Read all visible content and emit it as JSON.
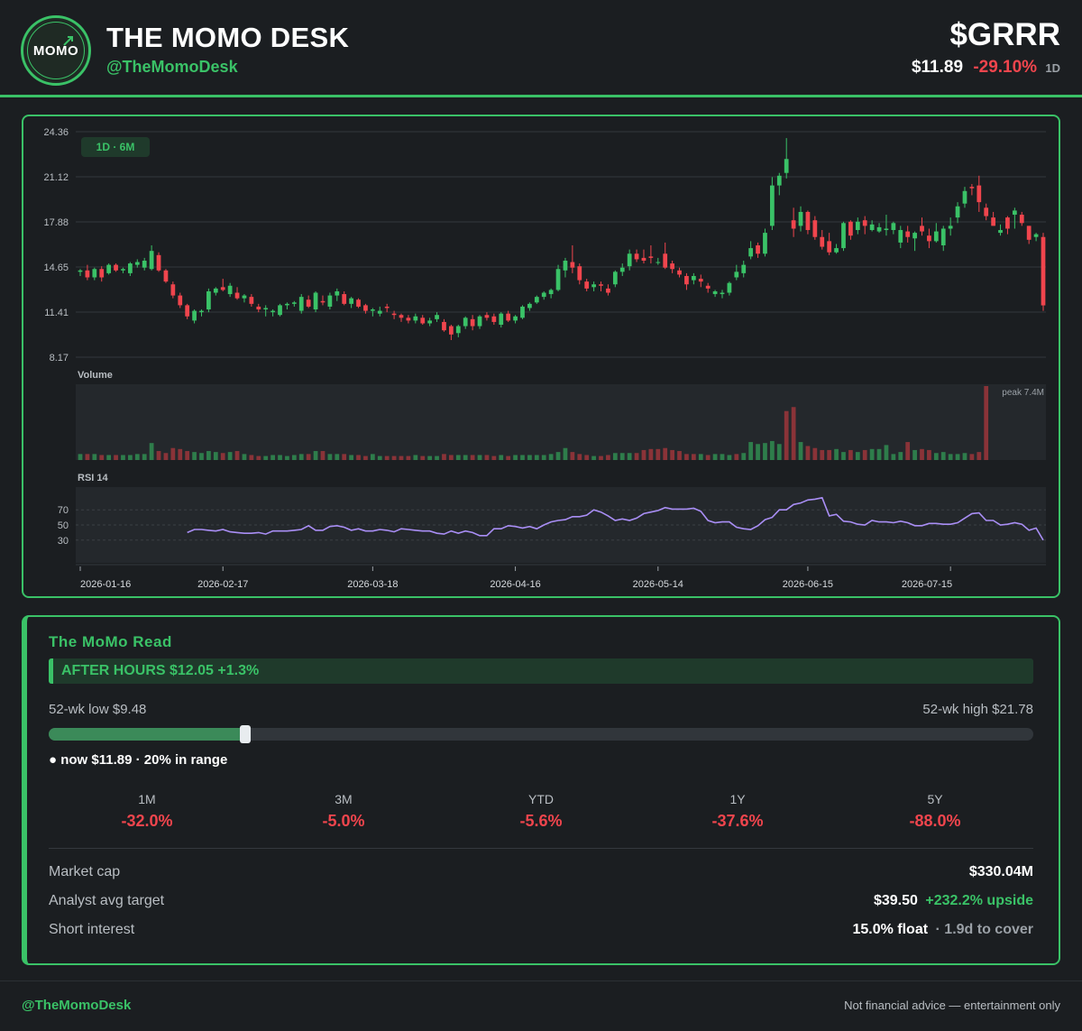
{
  "header": {
    "logo_text": "MOMO",
    "brand_name": "THE MOMO DESK",
    "handle": "@TheMomoDesk",
    "ticker": "$GRRR",
    "price": "$11.89",
    "change": "-29.10%",
    "period": "1D"
  },
  "colors": {
    "accent": "#3ac267",
    "up": "#3ac267",
    "down": "#f0454d",
    "rsi_line": "#a98ef5",
    "background": "#1b1e21"
  },
  "chart_data": {
    "type": "candlestick",
    "badge": "1D · 6M",
    "y_ticks": [
      24.36,
      21.12,
      17.88,
      14.65,
      11.41,
      8.17
    ],
    "ylim": [
      8.17,
      24.36
    ],
    "x_tick_labels": [
      "2026-01-16",
      "2026-02-17",
      "2026-03-18",
      "2026-04-16",
      "2026-05-14",
      "2026-06-15",
      "2026-07-15"
    ],
    "x_tick_index": [
      0,
      20,
      41,
      61,
      81,
      102,
      122
    ],
    "ohlc": [
      [
        14.3,
        14.5,
        14.0,
        14.4
      ],
      [
        14.4,
        14.8,
        13.7,
        13.9
      ],
      [
        13.9,
        14.6,
        13.7,
        14.5
      ],
      [
        14.5,
        14.7,
        13.6,
        13.9
      ],
      [
        14.2,
        14.9,
        14.1,
        14.8
      ],
      [
        14.8,
        14.9,
        14.3,
        14.4
      ],
      [
        14.4,
        14.6,
        14.2,
        14.5
      ],
      [
        14.2,
        15.0,
        14.0,
        14.9
      ],
      [
        14.8,
        15.2,
        14.6,
        15.0
      ],
      [
        14.6,
        15.3,
        14.4,
        15.1
      ],
      [
        14.5,
        16.2,
        14.4,
        15.8
      ],
      [
        15.5,
        15.7,
        14.3,
        14.4
      ],
      [
        14.4,
        14.5,
        13.5,
        13.6
      ],
      [
        13.4,
        13.6,
        12.4,
        12.6
      ],
      [
        12.6,
        12.8,
        11.7,
        11.9
      ],
      [
        11.9,
        12.0,
        10.9,
        11.1
      ],
      [
        10.8,
        11.6,
        10.6,
        11.5
      ],
      [
        11.4,
        11.6,
        11.1,
        11.5
      ],
      [
        11.6,
        13.1,
        11.4,
        12.9
      ],
      [
        12.8,
        13.2,
        12.6,
        13.1
      ],
      [
        13.2,
        13.8,
        12.9,
        13.0
      ],
      [
        12.7,
        13.5,
        12.5,
        13.3
      ],
      [
        12.8,
        13.2,
        12.3,
        12.4
      ],
      [
        12.4,
        12.7,
        12.1,
        12.6
      ],
      [
        12.5,
        12.7,
        11.8,
        12.0
      ],
      [
        11.8,
        12.0,
        11.4,
        11.6
      ],
      [
        11.6,
        11.9,
        11.1,
        11.7
      ],
      [
        11.4,
        11.6,
        11.1,
        11.5
      ],
      [
        11.2,
        12.0,
        11.1,
        11.9
      ],
      [
        11.9,
        12.1,
        11.6,
        12.0
      ],
      [
        12.0,
        12.2,
        11.8,
        12.1
      ],
      [
        11.5,
        12.7,
        11.3,
        12.5
      ],
      [
        12.3,
        12.6,
        11.7,
        11.8
      ],
      [
        11.6,
        12.9,
        11.4,
        12.8
      ],
      [
        12.2,
        12.6,
        11.9,
        12.1
      ],
      [
        11.8,
        12.8,
        11.6,
        12.6
      ],
      [
        12.6,
        13.1,
        12.2,
        12.9
      ],
      [
        12.7,
        12.9,
        11.9,
        12.0
      ],
      [
        12.0,
        12.5,
        11.7,
        12.4
      ],
      [
        12.3,
        12.4,
        11.7,
        11.8
      ],
      [
        11.9,
        12.0,
        11.3,
        11.5
      ],
      [
        11.5,
        11.7,
        11.1,
        11.6
      ],
      [
        11.3,
        11.8,
        11.1,
        11.5
      ],
      [
        11.8,
        12.0,
        11.4,
        11.7
      ],
      [
        11.3,
        11.5,
        10.9,
        11.2
      ],
      [
        11.2,
        11.3,
        10.7,
        11.0
      ],
      [
        11.0,
        11.2,
        10.6,
        10.8
      ],
      [
        10.8,
        11.3,
        10.6,
        11.1
      ],
      [
        11.0,
        11.2,
        10.5,
        10.6
      ],
      [
        10.6,
        11.0,
        10.4,
        10.8
      ],
      [
        10.9,
        11.4,
        10.7,
        11.2
      ],
      [
        10.7,
        10.9,
        10.0,
        10.1
      ],
      [
        10.4,
        10.5,
        9.4,
        9.8
      ],
      [
        9.9,
        10.5,
        9.6,
        10.4
      ],
      [
        10.4,
        11.1,
        10.2,
        11.0
      ],
      [
        10.9,
        11.2,
        10.1,
        10.4
      ],
      [
        10.4,
        11.2,
        10.2,
        11.1
      ],
      [
        11.2,
        11.4,
        10.8,
        11.0
      ],
      [
        11.1,
        11.3,
        10.5,
        10.7
      ],
      [
        10.5,
        11.4,
        10.3,
        11.3
      ],
      [
        11.3,
        11.5,
        10.7,
        10.8
      ],
      [
        10.8,
        11.2,
        10.6,
        11.1
      ],
      [
        11.0,
        11.9,
        10.9,
        11.8
      ],
      [
        11.7,
        12.1,
        11.5,
        12.0
      ],
      [
        12.1,
        12.6,
        12.0,
        12.5
      ],
      [
        12.5,
        12.9,
        12.3,
        12.8
      ],
      [
        12.7,
        13.1,
        12.4,
        13.0
      ],
      [
        13.0,
        14.8,
        12.9,
        14.5
      ],
      [
        14.4,
        15.3,
        13.9,
        15.1
      ],
      [
        15.0,
        16.2,
        14.2,
        14.6
      ],
      [
        14.7,
        14.9,
        13.4,
        13.7
      ],
      [
        13.6,
        13.8,
        12.9,
        13.1
      ],
      [
        13.2,
        13.6,
        12.9,
        13.4
      ],
      [
        13.4,
        13.6,
        12.9,
        13.3
      ],
      [
        13.1,
        13.4,
        12.6,
        12.8
      ],
      [
        13.4,
        14.4,
        13.2,
        14.3
      ],
      [
        14.3,
        14.9,
        14.0,
        14.6
      ],
      [
        14.7,
        15.9,
        14.4,
        15.6
      ],
      [
        15.6,
        15.9,
        15.0,
        15.2
      ],
      [
        15.3,
        15.9,
        14.9,
        15.1
      ],
      [
        15.4,
        16.2,
        14.9,
        15.3
      ],
      [
        15.0,
        15.3,
        14.8,
        15.0
      ],
      [
        15.6,
        16.4,
        14.5,
        14.6
      ],
      [
        14.9,
        15.1,
        14.2,
        14.5
      ],
      [
        14.4,
        14.6,
        13.9,
        14.1
      ],
      [
        14.0,
        14.2,
        13.0,
        13.4
      ],
      [
        13.7,
        14.2,
        13.4,
        14.0
      ],
      [
        13.8,
        14.1,
        13.2,
        13.6
      ],
      [
        13.3,
        13.5,
        12.8,
        13.1
      ],
      [
        12.7,
        13.0,
        12.5,
        12.9
      ],
      [
        12.7,
        13.0,
        12.4,
        12.8
      ],
      [
        12.8,
        13.6,
        12.6,
        13.5
      ],
      [
        13.9,
        14.8,
        13.7,
        14.3
      ],
      [
        14.2,
        15.1,
        13.9,
        14.8
      ],
      [
        15.4,
        16.5,
        15.2,
        16.0
      ],
      [
        16.2,
        16.4,
        15.3,
        15.6
      ],
      [
        15.6,
        17.4,
        15.4,
        17.1
      ],
      [
        17.6,
        21.1,
        17.3,
        20.5
      ],
      [
        20.5,
        21.4,
        19.8,
        21.2
      ],
      [
        21.4,
        23.9,
        21.0,
        22.4
      ],
      [
        18.0,
        18.9,
        16.8,
        17.4
      ],
      [
        17.6,
        19.0,
        17.2,
        18.6
      ],
      [
        18.6,
        18.7,
        17.0,
        17.3
      ],
      [
        18.0,
        18.3,
        16.6,
        16.8
      ],
      [
        16.8,
        17.3,
        15.9,
        16.1
      ],
      [
        16.5,
        17.1,
        15.5,
        15.7
      ],
      [
        15.7,
        16.3,
        15.6,
        16.0
      ],
      [
        16.0,
        17.9,
        15.8,
        17.8
      ],
      [
        17.9,
        18.0,
        16.6,
        16.9
      ],
      [
        17.3,
        18.2,
        17.0,
        17.9
      ],
      [
        18.0,
        18.3,
        17.0,
        17.6
      ],
      [
        17.3,
        18.0,
        17.2,
        17.7
      ],
      [
        17.2,
        17.8,
        17.1,
        17.5
      ],
      [
        17.3,
        18.4,
        16.9,
        17.4
      ],
      [
        17.3,
        17.9,
        17.0,
        17.8
      ],
      [
        16.4,
        17.6,
        16.0,
        17.3
      ],
      [
        17.2,
        17.6,
        16.4,
        16.8
      ],
      [
        16.7,
        17.2,
        15.8,
        17.1
      ],
      [
        17.6,
        18.2,
        16.9,
        17.2
      ],
      [
        16.9,
        17.4,
        16.0,
        16.5
      ],
      [
        16.5,
        17.8,
        16.4,
        17.2
      ],
      [
        16.2,
        17.6,
        15.8,
        17.4
      ],
      [
        17.4,
        18.2,
        16.9,
        17.6
      ],
      [
        18.2,
        19.3,
        17.8,
        19.0
      ],
      [
        19.2,
        20.4,
        18.9,
        20.1
      ],
      [
        20.4,
        20.6,
        19.8,
        20.3
      ],
      [
        20.5,
        21.2,
        18.6,
        19.3
      ],
      [
        18.9,
        19.2,
        18.0,
        18.3
      ],
      [
        18.2,
        18.6,
        17.6,
        17.6
      ],
      [
        17.1,
        17.7,
        16.9,
        17.3
      ],
      [
        18.2,
        18.3,
        17.0,
        17.4
      ],
      [
        18.4,
        18.9,
        17.4,
        18.7
      ],
      [
        18.4,
        18.6,
        17.6,
        17.8
      ],
      [
        17.6,
        17.6,
        16.3,
        16.6
      ],
      [
        16.8,
        17.1,
        16.5,
        17.0
      ],
      [
        16.8,
        17.1,
        11.5,
        11.89
      ]
    ],
    "volume": {
      "label": "Volume",
      "peak_label": "peak 7.4M",
      "values_m": [
        0.6,
        0.6,
        0.6,
        0.5,
        0.5,
        0.5,
        0.5,
        0.5,
        0.6,
        0.6,
        1.7,
        0.9,
        0.7,
        1.2,
        1.1,
        0.9,
        0.8,
        0.7,
        0.9,
        0.8,
        0.7,
        0.8,
        0.9,
        0.6,
        0.5,
        0.4,
        0.4,
        0.5,
        0.5,
        0.4,
        0.5,
        0.6,
        0.6,
        0.9,
        0.9,
        0.6,
        0.6,
        0.6,
        0.5,
        0.5,
        0.4,
        0.6,
        0.4,
        0.4,
        0.4,
        0.4,
        0.4,
        0.5,
        0.4,
        0.4,
        0.4,
        0.6,
        0.5,
        0.5,
        0.5,
        0.5,
        0.5,
        0.5,
        0.4,
        0.5,
        0.4,
        0.5,
        0.5,
        0.5,
        0.5,
        0.5,
        0.6,
        0.8,
        1.2,
        0.8,
        0.6,
        0.5,
        0.4,
        0.4,
        0.5,
        0.7,
        0.7,
        0.7,
        0.7,
        1.0,
        1.1,
        1.1,
        1.2,
        1.0,
        0.9,
        0.6,
        0.6,
        0.6,
        0.5,
        0.6,
        0.6,
        0.5,
        0.6,
        0.7,
        1.8,
        1.6,
        1.7,
        1.9,
        1.6,
        4.9,
        5.3,
        1.8,
        1.4,
        1.2,
        1.0,
        1.0,
        1.1,
        0.8,
        1.0,
        0.8,
        1.0,
        1.1,
        1.1,
        1.5,
        0.6,
        0.8,
        1.8,
        1.0,
        1.1,
        1.0,
        0.7,
        0.8,
        0.6,
        0.6,
        0.7,
        0.6,
        0.8,
        7.4
      ],
      "up": [
        true,
        false,
        true,
        false,
        true,
        false,
        true,
        true,
        true,
        true,
        true,
        false,
        false,
        false,
        false,
        false,
        true,
        true,
        true,
        true,
        false,
        true,
        false,
        true,
        false,
        false,
        true,
        true,
        true,
        true,
        true,
        true,
        false,
        true,
        false,
        true,
        true,
        false,
        true,
        false,
        false,
        true,
        true,
        false,
        false,
        false,
        false,
        true,
        false,
        true,
        true,
        false,
        false,
        true,
        true,
        false,
        true,
        false,
        false,
        true,
        false,
        true,
        true,
        true,
        true,
        true,
        true,
        true,
        true,
        false,
        false,
        false,
        true,
        false,
        false,
        true,
        true,
        true,
        false,
        false,
        false,
        false,
        false,
        false,
        false,
        false,
        false,
        true,
        false,
        true,
        true,
        true,
        false,
        true,
        true,
        true,
        true,
        true,
        true,
        false,
        false,
        true,
        false,
        false,
        false,
        false,
        true,
        true,
        false,
        true,
        false,
        true,
        true,
        true,
        true,
        true,
        false,
        true,
        false,
        false,
        true,
        true,
        true,
        true,
        true,
        false,
        false,
        false,
        true,
        false,
        false
      ]
    },
    "rsi": {
      "label": "RSI 14",
      "ticks": [
        70,
        50,
        30
      ],
      "ylim": [
        0,
        100
      ],
      "start_index": 15,
      "values": [
        40,
        44,
        44,
        43,
        42,
        44,
        41,
        40,
        39,
        39,
        40,
        38,
        42,
        42,
        42,
        43,
        44,
        49,
        43,
        43,
        48,
        49,
        47,
        43,
        45,
        42,
        42,
        44,
        43,
        41,
        45,
        44,
        43,
        42,
        42,
        39,
        38,
        42,
        39,
        42,
        40,
        36,
        36,
        45,
        45,
        49,
        48,
        46,
        48,
        45,
        50,
        54,
        56,
        57,
        61,
        61,
        63,
        70,
        67,
        62,
        56,
        58,
        56,
        59,
        65,
        67,
        69,
        73,
        71,
        71,
        71,
        72,
        68,
        56,
        53,
        54,
        54,
        47,
        45,
        44,
        49,
        57,
        60,
        70,
        70,
        77,
        79,
        83,
        84,
        86,
        62,
        64,
        55,
        54,
        51,
        50,
        56,
        54,
        54,
        53,
        55,
        53,
        49,
        49,
        52,
        52,
        51,
        51,
        53,
        59,
        65,
        66,
        56,
        56,
        50,
        51,
        53,
        51,
        43,
        46,
        30
      ]
    },
    "last_price": 11.89
  },
  "read": {
    "title": "The MoMo Read",
    "after_hours": "AFTER HOURS $12.05 +1.3%",
    "wk_low": "52-wk low $9.48",
    "wk_high": "52-wk high $21.78",
    "range_position": 0.2,
    "now_text": "● now $11.89 · 20% in range",
    "performance": [
      {
        "label": "1M",
        "value": "-32.0%"
      },
      {
        "label": "3M",
        "value": "-5.0%"
      },
      {
        "label": "YTD",
        "value": "-5.6%"
      },
      {
        "label": "1Y",
        "value": "-37.6%"
      },
      {
        "label": "5Y",
        "value": "-88.0%"
      }
    ],
    "market_cap_label": "Market cap",
    "market_cap_value": "$330.04M",
    "target_label": "Analyst avg target",
    "target_value": "$39.50",
    "target_upside": "+232.2% upside",
    "short_label": "Short interest",
    "short_value": "15.0% float",
    "short_cover": "· 1.9d to cover"
  },
  "footer": {
    "handle": "@TheMomoDesk",
    "disclaimer": "Not financial advice — entertainment only"
  }
}
